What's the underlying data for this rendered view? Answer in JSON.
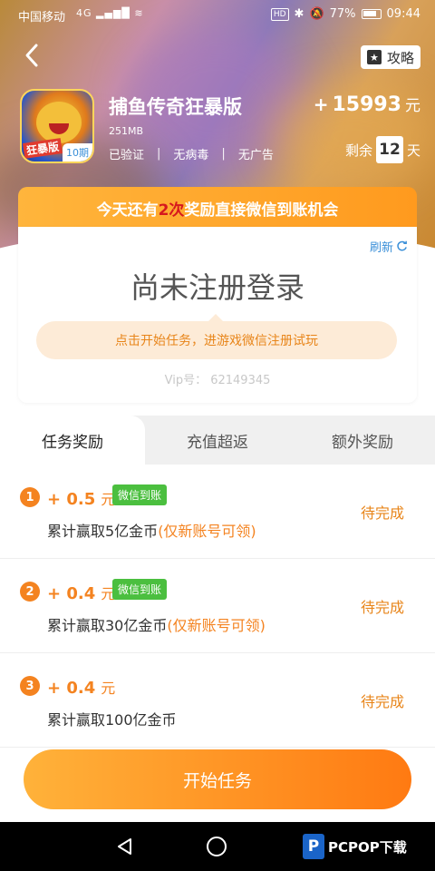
{
  "status_bar": {
    "carrier": "中国移动",
    "network": "4G",
    "battery": "77%",
    "time": "09:44"
  },
  "header": {
    "guide_label": "攻略"
  },
  "game": {
    "title": "捕鱼传奇狂暴版",
    "size": "251MB",
    "icon_tag": "狂暴版",
    "period": "10期",
    "tags": [
      "已验证",
      "无病毒",
      "无广告"
    ],
    "reward_plus": "+",
    "reward_amount": "15993",
    "reward_unit": "元",
    "remaining_prefix": "剩余",
    "remaining_days": "12",
    "remaining_suffix": "天"
  },
  "promo": {
    "prefix": "今天还有",
    "highlight": "2次",
    "suffix": "奖励直接微信到账机会"
  },
  "login_card": {
    "refresh_label": "刷新",
    "title": "尚未注册登录",
    "tip": "点击开始任务，进游戏微信注册试玩",
    "vip_id": "Vip号：  62149345"
  },
  "tabs": [
    {
      "label": "任务奖励",
      "active": true
    },
    {
      "label": "充值超返",
      "active": false
    },
    {
      "label": "额外奖励",
      "active": false
    }
  ],
  "tasks": [
    {
      "num": "1",
      "amount": "+ 0.5",
      "unit": "元",
      "badge": "微信到账",
      "desc": "累计赢取5亿金币",
      "note": "(仅新账号可领)",
      "status": "待完成"
    },
    {
      "num": "2",
      "amount": "+ 0.4",
      "unit": "元",
      "badge": "微信到账",
      "desc": "累计赢取30亿金币",
      "note": "(仅新账号可领)",
      "status": "待完成"
    },
    {
      "num": "3",
      "amount": "+ 0.4",
      "unit": "元",
      "badge": "",
      "desc": "累计赢取100亿金币",
      "note": "",
      "status": "待完成"
    }
  ],
  "start_button": "开始任务",
  "watermark": "PCPOP下载",
  "colors": {
    "accent_orange": "#f48320",
    "wechat_green": "#4bbf3f",
    "link_blue": "#3a8fd8",
    "highlight_red": "#d6181e"
  }
}
